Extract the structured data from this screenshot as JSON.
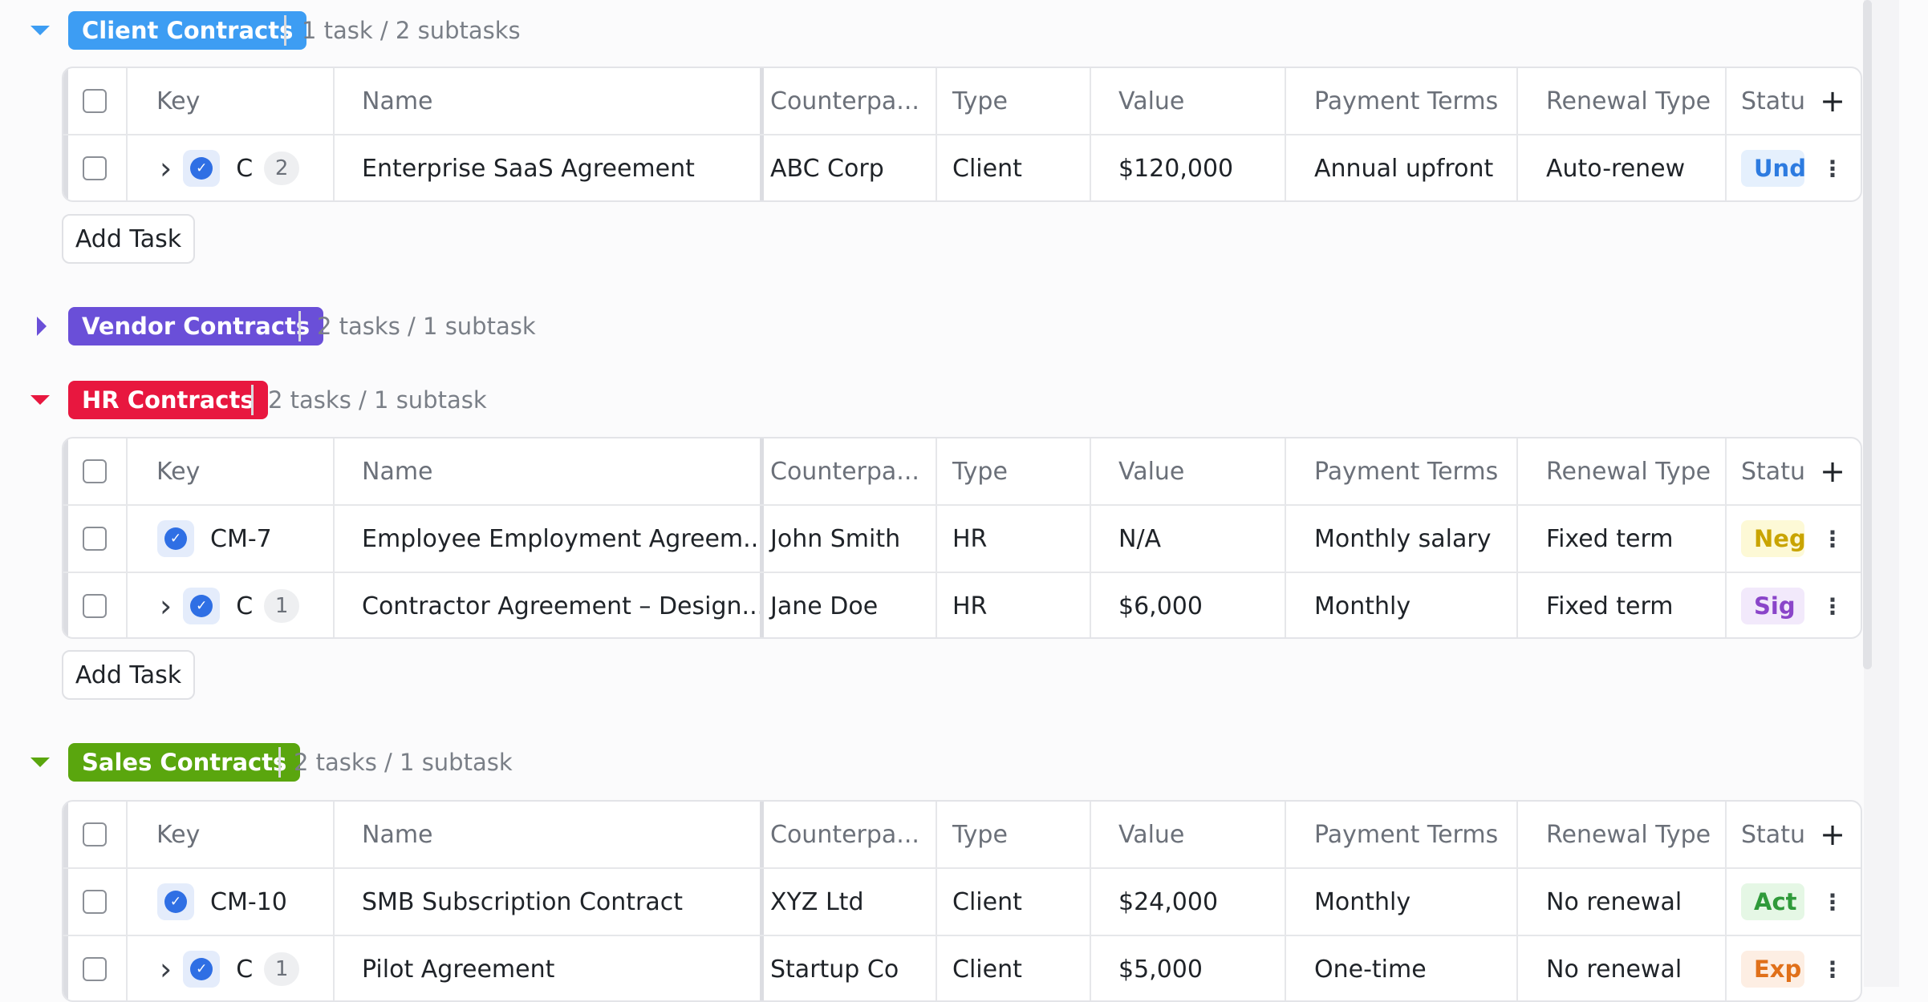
{
  "columns": {
    "key": "Key",
    "name": "Name",
    "counterparty": "Counterpa...",
    "type": "Type",
    "value": "Value",
    "payment_terms": "Payment Terms",
    "renewal_type": "Renewal Type",
    "status": "Status"
  },
  "add_task_label": "Add Task",
  "groups": [
    {
      "label": "Client Contracts",
      "count": "1 task / 2 subtasks",
      "color": "#3d9df3",
      "expanded": true,
      "rows": [
        {
          "key": "C",
          "subtasks": "2",
          "name": "Enterprise SaaS Agreement",
          "counterparty": "ABC Corp",
          "type": "Client",
          "value": "$120,000",
          "payment_terms": "Annual upfront",
          "renewal_type": "Auto-renew",
          "status": "Und",
          "status_bg": "#e5f0fd",
          "status_fg": "#2d7be0"
        }
      ]
    },
    {
      "label": "Vendor Contracts",
      "count": "2 tasks / 1 subtask",
      "color": "#6a4fd8",
      "expanded": false
    },
    {
      "label": "HR Contracts",
      "count": "2 tasks / 1 subtask",
      "color": "#e8173f",
      "expanded": true,
      "rows": [
        {
          "key": "CM-7",
          "subtasks": "",
          "name": "Employee Employment Agreem...",
          "counterparty": "John Smith",
          "type": "HR",
          "value": "N/A",
          "payment_terms": "Monthly salary",
          "renewal_type": "Fixed term",
          "status": "Neg",
          "status_bg": "#fdf9d6",
          "status_fg": "#c9a400"
        },
        {
          "key": "C",
          "subtasks": "1",
          "name": "Contractor Agreement – Design...",
          "counterparty": "Jane Doe",
          "type": "HR",
          "value": "$6,000",
          "payment_terms": "Monthly",
          "renewal_type": "Fixed term",
          "status": "Sig",
          "status_bg": "#f2e9fb",
          "status_fg": "#8a45c9"
        }
      ]
    },
    {
      "label": "Sales Contracts",
      "count": "2 tasks / 1 subtask",
      "color": "#5aa60e",
      "expanded": true,
      "rows": [
        {
          "key": "CM-10",
          "subtasks": "",
          "name": "SMB Subscription Contract",
          "counterparty": "XYZ Ltd",
          "type": "Client",
          "value": "$24,000",
          "payment_terms": "Monthly",
          "renewal_type": "No renewal",
          "status": "Act",
          "status_bg": "#e5f7e5",
          "status_fg": "#2f9a3a"
        },
        {
          "key": "C",
          "subtasks": "1",
          "name": "Pilot Agreement",
          "counterparty": "Startup Co",
          "type": "Client",
          "value": "$5,000",
          "payment_terms": "One-time",
          "renewal_type": "No renewal",
          "status": "Exp",
          "status_bg": "#fdeee3",
          "status_fg": "#e0701a"
        }
      ]
    }
  ]
}
